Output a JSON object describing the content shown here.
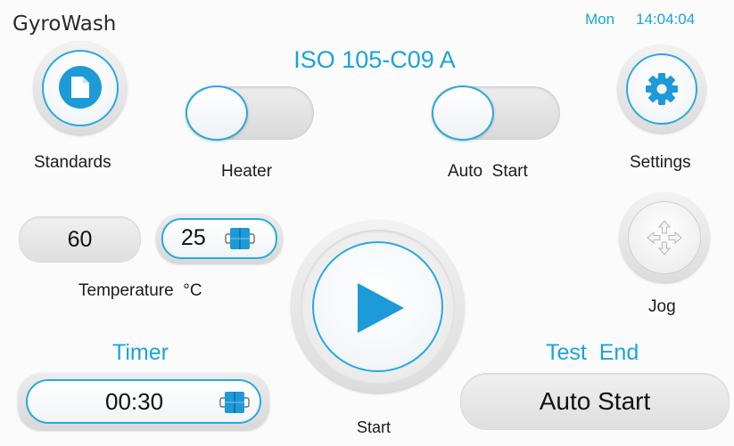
{
  "app": {
    "title": "GyroWash"
  },
  "status": {
    "day": "Mon",
    "time": "14:04:04"
  },
  "program": {
    "name": "ISO 105-C09 A"
  },
  "buttons": {
    "standards_label": "Standards",
    "settings_label": "Settings",
    "jog_label": "Jog",
    "start_label": "Start"
  },
  "toggles": {
    "heater": {
      "label": "Heater",
      "on": false
    },
    "auto_start": {
      "label": "Auto  Start",
      "on": false
    }
  },
  "temperature": {
    "actual": "60",
    "setpoint": "25",
    "label": "Temperature  °C"
  },
  "timer": {
    "title": "Timer",
    "value": "00:30"
  },
  "test_end": {
    "title": "Test  End",
    "value": "Auto Start"
  },
  "icons": {
    "standards": "document-icon",
    "settings": "gear-icon",
    "jog": "move-arrows-icon",
    "start": "play-icon",
    "stepper": "stepper-icon"
  },
  "colors": {
    "accent": "#1aa3dc",
    "background": "#fbfbfb"
  }
}
